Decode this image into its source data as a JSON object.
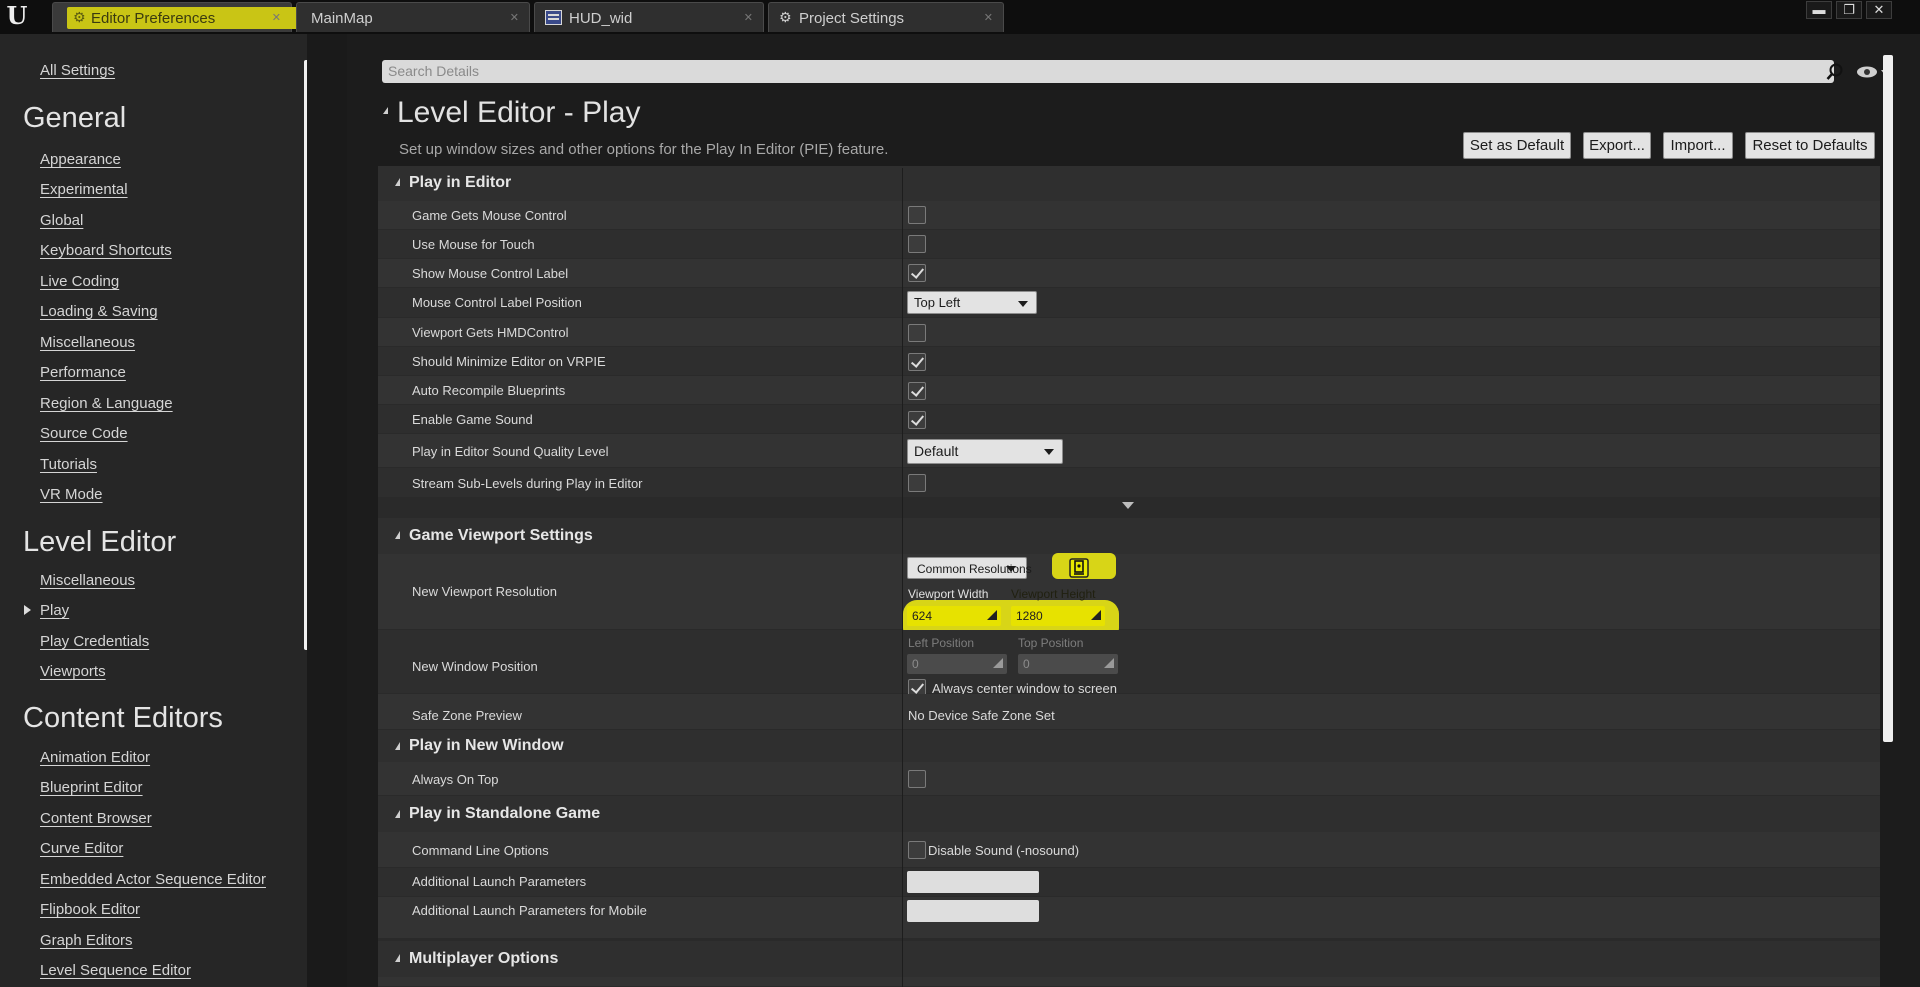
{
  "tabs": [
    {
      "label": "Editor Preferences",
      "active": true
    },
    {
      "label": "MainMap",
      "active": false
    },
    {
      "label": "HUD_wid",
      "active": false
    },
    {
      "label": "Project Settings",
      "active": false
    }
  ],
  "window_controls": {
    "minimize": "▬",
    "restore": "❐",
    "close": "✕"
  },
  "nav": {
    "all_settings": "All Settings",
    "general": {
      "heading": "General",
      "items": [
        "Appearance",
        "Experimental",
        "Global",
        "Keyboard Shortcuts",
        "Live Coding",
        "Loading & Saving",
        "Miscellaneous",
        "Performance",
        "Region & Language",
        "Source Code",
        "Tutorials",
        "VR Mode"
      ]
    },
    "level_editor": {
      "heading": "Level Editor",
      "items": [
        "Miscellaneous",
        "Play",
        "Play Credentials",
        "Viewports"
      ],
      "selected": "Play"
    },
    "content_editors": {
      "heading": "Content Editors",
      "items": [
        "Animation Editor",
        "Blueprint Editor",
        "Content Browser",
        "Curve Editor",
        "Embedded Actor Sequence Editor",
        "Flipbook Editor",
        "Graph Editors",
        "Level Sequence Editor"
      ]
    }
  },
  "search": {
    "placeholder": "Search Details"
  },
  "page": {
    "title": "Level Editor - Play",
    "description": "Set up window sizes and other options for the Play In Editor (PIE) feature.",
    "buttons": {
      "set_default": "Set as Default",
      "export": "Export...",
      "import": "Import...",
      "reset": "Reset to Defaults"
    }
  },
  "categories": {
    "play_in_editor": "Play in Editor",
    "game_viewport": "Game Viewport Settings",
    "play_new_window": "Play in New Window",
    "standalone": "Play in Standalone Game",
    "multiplayer": "Multiplayer Options"
  },
  "play_in_editor": [
    {
      "label": "Game Gets Mouse Control",
      "checked": false
    },
    {
      "label": "Use Mouse for Touch",
      "checked": false
    },
    {
      "label": "Show Mouse Control Label",
      "checked": true
    },
    {
      "label": "Mouse Control Label Position",
      "value": "Top Left"
    },
    {
      "label": "Viewport Gets HMDControl",
      "checked": false
    },
    {
      "label": "Should Minimize Editor on VRPIE",
      "checked": true
    },
    {
      "label": "Auto Recompile Blueprints",
      "checked": true
    },
    {
      "label": "Enable Game Sound",
      "checked": true
    },
    {
      "label": "Play in Editor Sound Quality Level",
      "value": "Default"
    },
    {
      "label": "Stream Sub-Levels during Play in Editor",
      "checked": false
    }
  ],
  "game_viewport": {
    "resolution_label": "New Viewport Resolution",
    "common_resolutions": "Common Resolutions",
    "width_label": "Viewport Width",
    "height_label": "Viewport Height",
    "width_value": "624",
    "height_value": "1280",
    "window_position_label": "New Window Position",
    "left_position_label": "Left Position",
    "top_position_label": "Top Position",
    "left_position_value": "0",
    "top_position_value": "0",
    "center_window_label": "Always center window to screen",
    "center_window_checked": true,
    "safe_zone_label": "Safe Zone Preview",
    "safe_zone_value": "No Device Safe Zone Set"
  },
  "play_new_window": {
    "always_on_top_label": "Always On Top",
    "always_on_top_checked": false
  },
  "standalone": {
    "command_line_label": "Command Line Options",
    "disable_sound_label": "Disable Sound (-nosound)",
    "additional_params_label": "Additional Launch Parameters",
    "additional_params_mobile_label": "Additional Launch Parameters for Mobile"
  },
  "colors": {
    "highlight": "#d8d517",
    "panel": "#2a2a2a",
    "row": "#333333"
  }
}
